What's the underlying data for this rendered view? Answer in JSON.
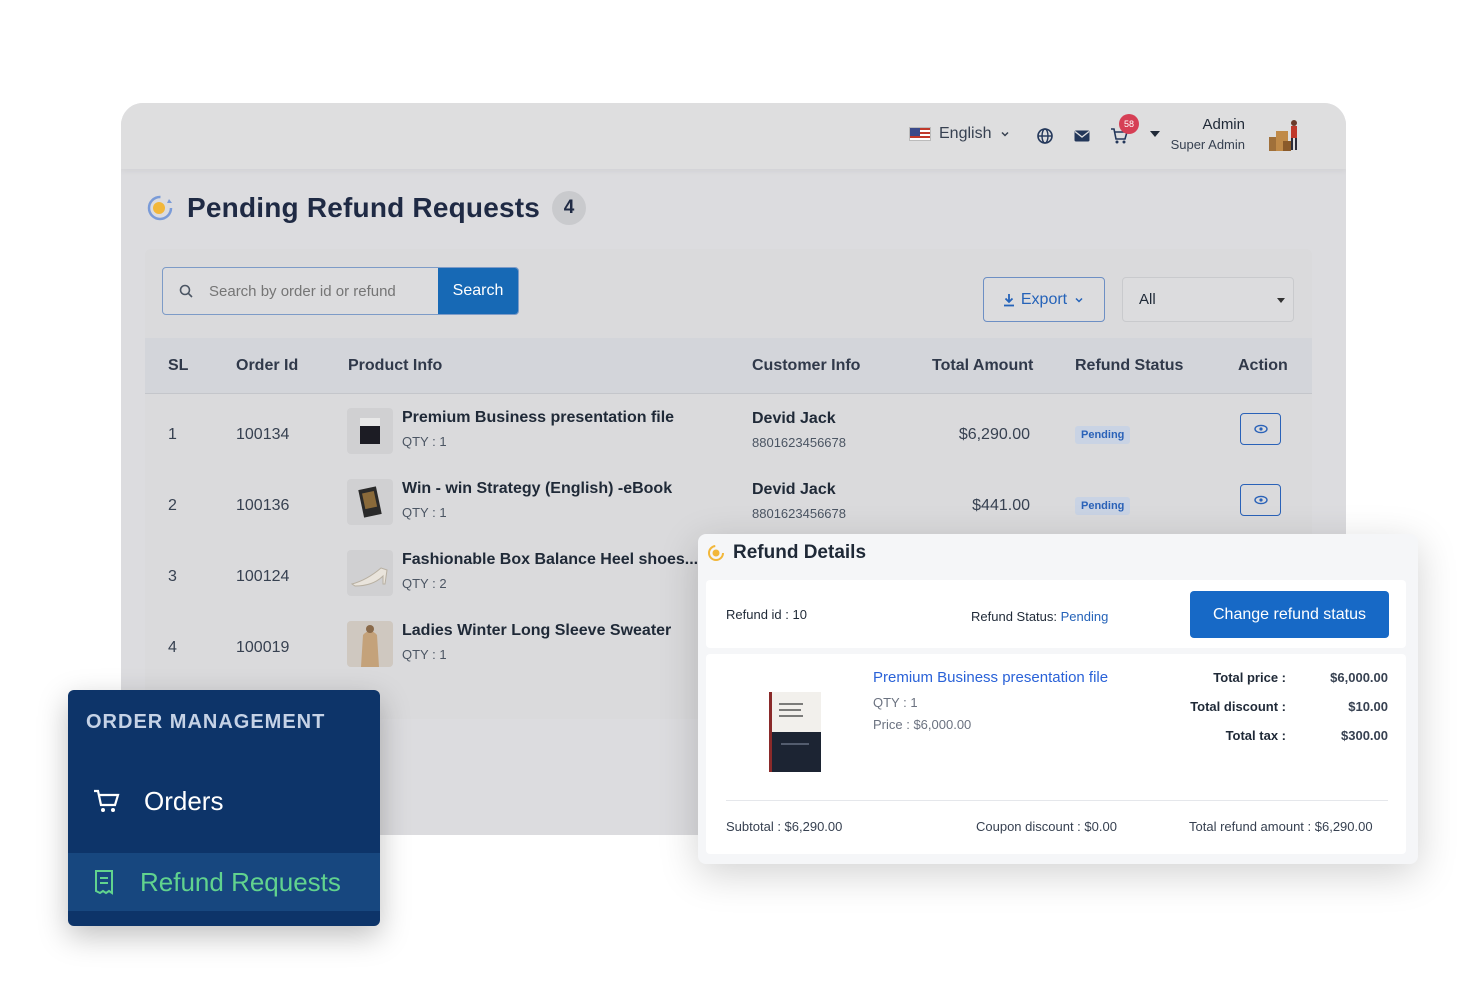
{
  "topbar": {
    "language": "English",
    "cart_count": "58",
    "admin_name": "Admin",
    "admin_role": "Super Admin"
  },
  "page": {
    "title": "Pending Refund Requests",
    "count": "4"
  },
  "toolbar": {
    "search_placeholder": "Search by order id or refund",
    "search_label": "Search",
    "export_label": "Export",
    "filter_value": "All"
  },
  "table": {
    "headers": [
      "SL",
      "Order Id",
      "Product Info",
      "Customer Info",
      "Total Amount",
      "Refund Status",
      "Action"
    ],
    "rows": [
      {
        "sl": "1",
        "order_id": "100134",
        "product": "Premium Business presentation file",
        "qty": "QTY : 1",
        "customer": "Devid Jack",
        "phone": "8801623456678",
        "amount": "$6,290.00",
        "status": "Pending"
      },
      {
        "sl": "2",
        "order_id": "100136",
        "product": "Win - win Strategy (English) -eBook",
        "qty": "QTY : 1",
        "customer": "Devid Jack",
        "phone": "8801623456678",
        "amount": "$441.00",
        "status": "Pending"
      },
      {
        "sl": "3",
        "order_id": "100124",
        "product": "Fashionable Box Balance Heel shoes...",
        "qty": "QTY : 2"
      },
      {
        "sl": "4",
        "order_id": "100019",
        "product": "Ladies Winter Long Sleeve Sweater",
        "qty": "QTY : 1"
      }
    ]
  },
  "sidebar": {
    "section_title": "ORDER MANAGEMENT",
    "items": [
      {
        "label": "Orders"
      },
      {
        "label": "Refund Requests"
      }
    ],
    "active_color": "#61d38e"
  },
  "refund_details": {
    "title": "Refund Details",
    "refund_id": "Refund id : 10",
    "status_label": "Refund Status:",
    "status_value": "Pending",
    "change_button": "Change refund status",
    "product_name": "Premium Business presentation file",
    "product_qty": "QTY : 1",
    "product_price": "Price : $6,000.00",
    "total_price_label": "Total price :",
    "total_price": "$6,000.00",
    "total_discount_label": "Total discount :",
    "total_discount": "$10.00",
    "total_tax_label": "Total tax :",
    "total_tax": "$300.00",
    "subtotal": "Subtotal : $6,290.00",
    "coupon_discount": "Coupon discount : $0.00",
    "total_refund": "Total refund amount : $6,290.00"
  },
  "colors": {
    "primary": "#1769b5",
    "sidebar_bg": "#0d3469",
    "pending_text": "#2a62b8"
  }
}
